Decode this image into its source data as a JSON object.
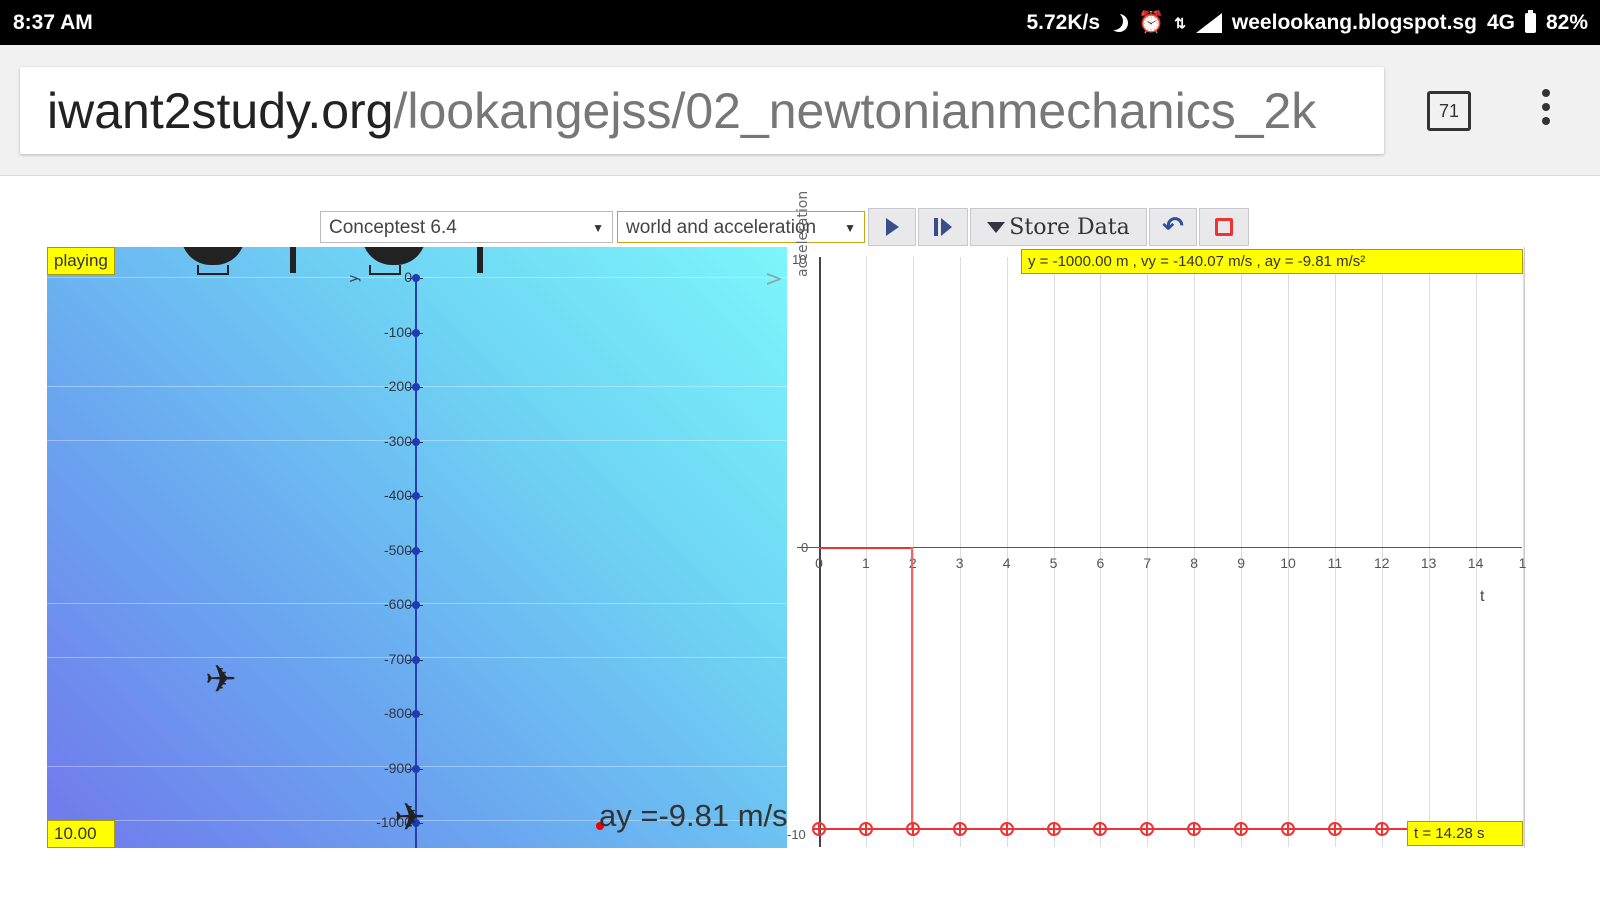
{
  "status_bar": {
    "time": "8:37 AM",
    "net_speed": "5.72K/s",
    "site": "weelookang.blogspot.sg",
    "network": "4G",
    "battery": "82%"
  },
  "browser": {
    "url_domain": "iwant2study.org",
    "url_path": "/lookangejss/02_newtonianmechanics_2k",
    "tab_count": "71"
  },
  "toolbar": {
    "scenario": "Conceptest 6.4",
    "view": "world and acceleration",
    "store_label": "Store Data"
  },
  "world": {
    "status": "playing",
    "time_readout": "10.00",
    "y_axis_label": "y",
    "y_ticks": [
      "0",
      "-100",
      "-200",
      "-300",
      "-400",
      "-500",
      "-600",
      "-700",
      "-800",
      "-900",
      "-1000"
    ],
    "ay_label": "ay =-9.81 m/s"
  },
  "graph": {
    "readout": "y = -1000.00 m , vy = -140.07 m/s , ay = -9.81 m/s²",
    "time_label": "t = 14.28 s",
    "y_axis_title": "acceleration",
    "x_axis_title": "t",
    "y_top": "10",
    "y_zero": "0",
    "y_bottom": "-10",
    "x_ticks": [
      "0",
      "1",
      "2",
      "3",
      "4",
      "5",
      "6",
      "7",
      "8",
      "9",
      "10",
      "11",
      "12",
      "13",
      "14",
      "1"
    ]
  },
  "colors": {
    "accent_yellow": "#ffff00",
    "trace_red": "#ee3333",
    "axis_blue": "#1e3ab5"
  }
}
